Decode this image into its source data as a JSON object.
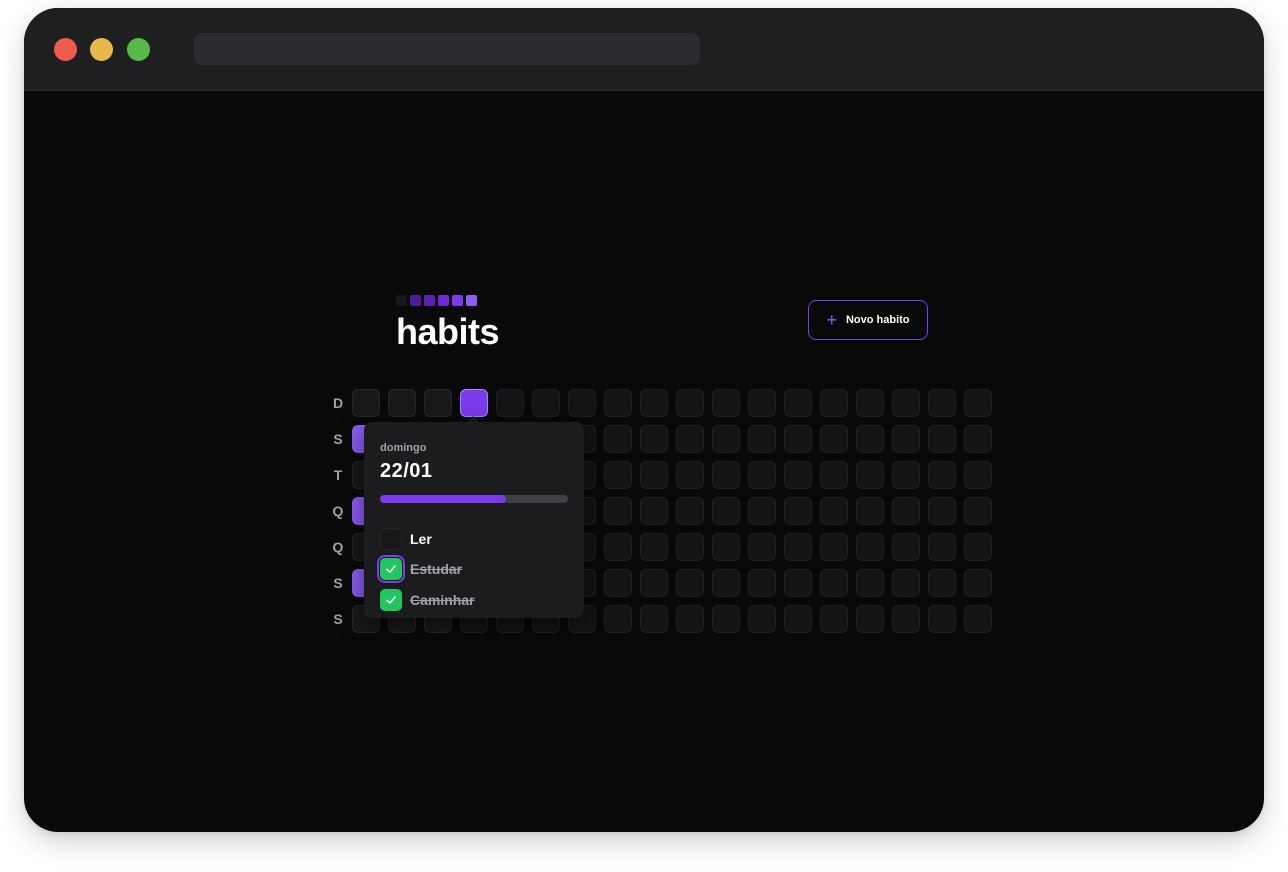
{
  "browser": {
    "url": ""
  },
  "app": {
    "logo_text": "habits",
    "logo_squares": [
      "#18181b",
      "#4c1d95",
      "#5b21b6",
      "#6d28d9",
      "#7c3aed",
      "#8b5cf6"
    ]
  },
  "toolbar": {
    "new_habit_label": "Novo habito",
    "new_habit_icon": "plus-icon"
  },
  "weekdays": [
    "D",
    "S",
    "T",
    "Q",
    "Q",
    "S",
    "S"
  ],
  "summary": {
    "weeks": 18,
    "active_weeks": 3,
    "filled_cells": [
      {
        "week": 3,
        "day": 0
      },
      {
        "week": 0,
        "day": 1
      },
      {
        "week": 0,
        "day": 3
      },
      {
        "week": 0,
        "day": 5
      }
    ]
  },
  "popover": {
    "weekday": "domingo",
    "date": "22/01",
    "progress": 0.67,
    "habits": [
      {
        "label": "Ler",
        "done": false
      },
      {
        "label": "Estudar",
        "done": true
      },
      {
        "label": "Caminhar",
        "done": true
      }
    ]
  },
  "colors": {
    "accent": "#7c3aed",
    "success": "#22c55e",
    "background": "#09090a"
  }
}
